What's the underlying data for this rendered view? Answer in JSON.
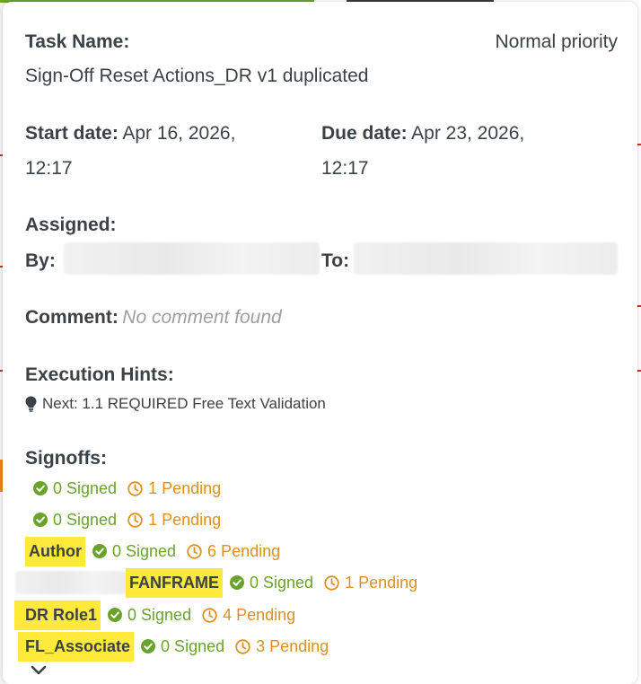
{
  "task": {
    "name_label": "Task Name:",
    "name": "Sign-Off Reset Actions_DR v1 duplicated",
    "priority": "Normal priority",
    "start_label": "Start date:",
    "start_value": "Apr 16, 2026,",
    "start_time": "12:17",
    "due_label": "Due date:",
    "due_value": "Apr 23, 2026,",
    "due_time": "12:17",
    "assigned_label": "Assigned:",
    "by_label": "By:",
    "to_label": "To:",
    "comment_label": "Comment:",
    "comment_value": "No comment found",
    "hints_label": "Execution Hints:",
    "hint_text": "Next: 1.1 REQUIRED Free Text Validation"
  },
  "signoffs": {
    "label": "Signoffs:",
    "rows": [
      {
        "tag": "",
        "signed": "0 Signed",
        "pending": "1 Pending"
      },
      {
        "tag": "",
        "signed": "0 Signed",
        "pending": "1 Pending"
      },
      {
        "tag": "Author",
        "signed": "0 Signed",
        "pending": "6 Pending"
      },
      {
        "tag": "FANFRAME",
        "signed": "0 Signed",
        "pending": "1 Pending"
      },
      {
        "tag": "DR Role1",
        "signed": "0 Signed",
        "pending": "4 Pending"
      },
      {
        "tag": "FL_Associate",
        "signed": "0 Signed",
        "pending": "3 Pending"
      }
    ]
  },
  "icons": {
    "hint": "lightbulb-icon",
    "signed": "check-circle-icon",
    "pending": "clock-icon",
    "expand": "chevron-down-icon"
  },
  "colors": {
    "signed": "#6aa32b",
    "pending": "#e18f1d",
    "highlight": "#ffe93b"
  }
}
